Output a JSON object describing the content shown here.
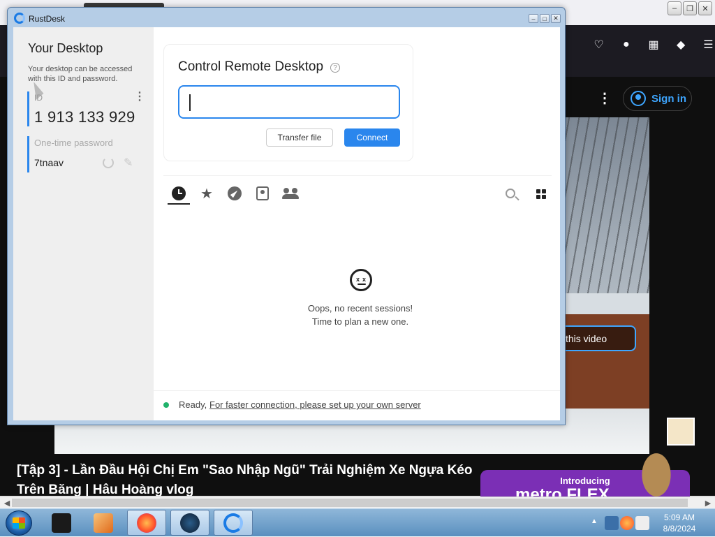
{
  "rustdesk": {
    "window_title": "RustDesk",
    "left": {
      "title": "Your Desktop",
      "description": "Your desktop can be accessed with this ID and password.",
      "id_label": "ID",
      "id_value": "1 913 133 929",
      "password_label": "One-time password",
      "password_value": "7tnaav"
    },
    "main": {
      "card_title": "Control Remote Desktop",
      "id_input_value": "",
      "transfer_label": "Transfer file",
      "connect_label": "Connect",
      "tabs": [
        "recent-sessions",
        "favorites",
        "discovered",
        "address-book",
        "accessible-devices"
      ],
      "empty_line1": "Oops, no recent sessions!",
      "empty_line2": "Time to plan a new one.",
      "status_ready": "Ready,",
      "status_link": "For faster connection, please set up your own server"
    }
  },
  "background": {
    "signin_label": "Sign in",
    "watch_label": "this video",
    "video_title": "[Tập 3] - Lần Đầu Hội Chị Em \"Sao Nhập Ngũ\" Trải Nghiệm Xe Ngựa Kéo Trên Băng | Hâu Hoàng vlog",
    "ad_line1": "Introducing",
    "ad_line2": "metro FLEX"
  },
  "taskbar": {
    "time": "5:09 AM",
    "date": "8/8/2024"
  },
  "colors": {
    "accent": "#2a86ed",
    "status_ok": "#20b26b"
  }
}
